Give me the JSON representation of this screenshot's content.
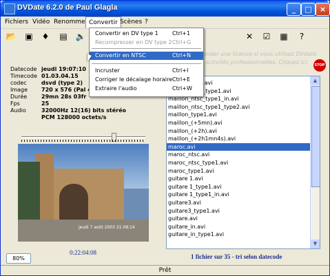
{
  "window": {
    "title": "DVDate 6.2.0 de Paul Glagla"
  },
  "menubar": [
    "Fichiers",
    "Vidéo",
    "Renommer",
    "Convertir",
    "Scènes",
    "?"
  ],
  "convertir_menu": [
    {
      "label": "Convertir en DV type 1",
      "shortcut": "Ctrl+1",
      "state": "normal"
    },
    {
      "label": "Recompresser en DV type 2",
      "shortcut": "Ctrl+G",
      "state": "disabled"
    },
    {
      "label": "Convertir en NTSC",
      "shortcut": "Ctrl+N",
      "state": "highlight"
    },
    {
      "label": "Incruster",
      "shortcut": "Ctrl+I",
      "state": "normal"
    },
    {
      "label": "Corriger le décalage horaire",
      "shortcut": "Ctrl+E",
      "state": "normal"
    },
    {
      "label": "Extraire l'audio",
      "shortcut": "Ctrl+W",
      "state": "normal"
    }
  ],
  "license_notice": "mander une licence si vous utilisez DVdate activités professionnelles. Cliquez ici.",
  "info": {
    "datecode": {
      "label": "Datecode",
      "value": "jeudi 19:07:10"
    },
    "timecode": {
      "label": "Timecode",
      "value": "01.03.04.15"
    },
    "codec": {
      "label": "codec",
      "value": "dsvd (type 2)"
    },
    "image": {
      "label": "Image",
      "value": "720 x 576 (Pal 4"
    },
    "duree": {
      "label": "Durée",
      "value": "29mn 28s 03fr"
    },
    "fps": {
      "label": "Fps",
      "value": "25"
    },
    "audio": {
      "label": "Audio",
      "value": "32000Hz 12(16) bits  stéréo"
    },
    "audio2": {
      "value": "PCM 128000 octets/s"
    }
  },
  "video": {
    "overlay": "jeudi 7 août 2003 21:08:14"
  },
  "zoom": "80%",
  "current_time": "0:22:04:08",
  "files": [
    "maillon_ntsc.avi",
    "maillon_ntsc_type1.avi",
    "maillon_ntsc_type1_in.avi",
    "maillon_ntsc_type1_type2.avi",
    "maillon_type1.avi",
    "maillon_(+5mn).avi",
    "maillon_(+2h).avi",
    "maillon_(+2h1mn4s).avi",
    "maroc.avi",
    "maroc_ntsc.avi",
    "maroc_ntsc_type1.avi",
    "maroc_type1.avi",
    "guitare 1.avi",
    "guitare 1_type1.avi",
    "guitare 1_type1_in.avi",
    "guitare3.avi",
    "guitare3_type1.avi",
    "guitare.avi",
    "guitare_in.avi",
    "guitare_in_type1.avi"
  ],
  "selected_file": "maroc.avi",
  "list_status": "1 fichier sur 35 - tri selon datecode",
  "statusbar": "Prêt",
  "colors": {
    "title_bar": "#0a5fe8",
    "selection": "#316ac5",
    "status_text": "#1c2f8f",
    "stop_button": "#d40000"
  },
  "icons": [
    "open-folder-icon",
    "copy-icon",
    "delete-icon",
    "rename-icon",
    "speaker-icon",
    "scissors-icon",
    "checkmark-icon",
    "settings-icon",
    "help-icon",
    "stop-icon"
  ]
}
